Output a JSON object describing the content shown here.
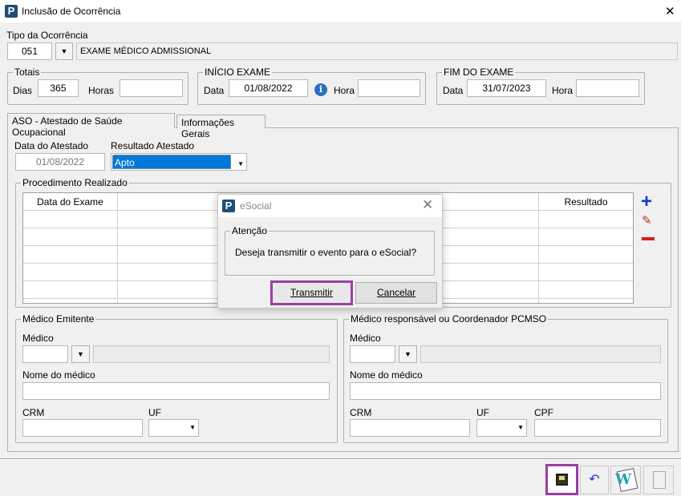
{
  "window": {
    "title": "Inclusão de Ocorrência",
    "close": "✕"
  },
  "tipo": {
    "label": "Tipo da Ocorrência",
    "code": "051",
    "description": "EXAME MÉDICO ADMISSIONAL"
  },
  "totais": {
    "legend": "Totais",
    "dias_label": "Dias",
    "dias": "365",
    "horas_label": "Horas",
    "horas": ""
  },
  "inicio": {
    "legend": "INÍCIO EXAME",
    "data_label": "Data",
    "data": "01/08/2022",
    "hora_label": "Hora",
    "hora": ""
  },
  "fim": {
    "legend": "FIM DO EXAME",
    "data_label": "Data",
    "data": "31/07/2023",
    "hora_label": "Hora",
    "hora": ""
  },
  "tabs": [
    {
      "label": "ASO - Atestado de Saúde Ocupacional",
      "active": true
    },
    {
      "label": "Informações Gerais",
      "active": false
    }
  ],
  "aso": {
    "data_label": "Data do Atestado",
    "data": "01/08/2022",
    "resultado_label": "Resultado Atestado",
    "resultado": "Apto"
  },
  "procedimento": {
    "legend": "Procedimento Realizado",
    "columns": [
      "Data do Exame",
      "",
      "Resultado"
    ]
  },
  "medico_emitente": {
    "legend": "Médico Emitente",
    "medico_label": "Médico",
    "nome_label": "Nome do médico",
    "crm_label": "CRM",
    "uf_label": "UF"
  },
  "medico_resp": {
    "legend": "Médico responsável ou Coordenador PCMSO",
    "medico_label": "Médico",
    "nome_label": "Nome do médico",
    "crm_label": "CRM",
    "uf_label": "UF",
    "cpf_label": "CPF"
  },
  "dialog": {
    "title": "eSocial",
    "group": "Atenção",
    "message": "Deseja transmitir o evento para o eSocial?",
    "ok": "Transmitir",
    "cancel": "Cancelar"
  },
  "colors": {
    "highlight": "#9b3fa3",
    "selection": "#0078d7"
  }
}
